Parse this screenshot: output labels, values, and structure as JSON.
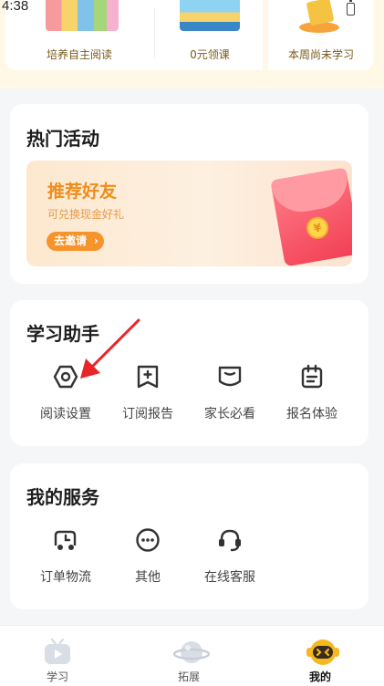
{
  "status_bar": {
    "time": "4:38"
  },
  "top_cards": [
    {
      "label": "培养自主阅读"
    },
    {
      "label": "0元领课"
    },
    {
      "label": "本周尚未学习"
    }
  ],
  "hot_activity": {
    "title": "热门活动",
    "banner": {
      "title": "推荐好友",
      "subtitle": "可兑换现金好礼",
      "button": "去邀请",
      "coin_symbol": "¥"
    }
  },
  "study_assistant": {
    "title": "学习助手",
    "items": [
      {
        "label": "阅读设置",
        "icon": "hexagon-settings-icon"
      },
      {
        "label": "订阅报告",
        "icon": "bookmark-plus-icon"
      },
      {
        "label": "家长必看",
        "icon": "book-shield-icon"
      },
      {
        "label": "报名体验",
        "icon": "clipboard-icon"
      }
    ]
  },
  "my_services": {
    "title": "我的服务",
    "items": [
      {
        "label": "订单物流",
        "icon": "delivery-truck-icon"
      },
      {
        "label": "其他",
        "icon": "more-dots-icon"
      },
      {
        "label": "在线客服",
        "icon": "headset-icon"
      }
    ]
  },
  "bottom_nav": [
    {
      "label": "学习",
      "icon": "tv-play-icon",
      "active": false
    },
    {
      "label": "拓展",
      "icon": "planet-icon",
      "active": false
    },
    {
      "label": "我的",
      "icon": "mascot-face-icon",
      "active": true
    }
  ],
  "colors": {
    "accent_orange": "#f7932b",
    "banner_title": "#f08c1a",
    "nav_active": "#f5b81f",
    "annotation_arrow": "#e8262a"
  }
}
